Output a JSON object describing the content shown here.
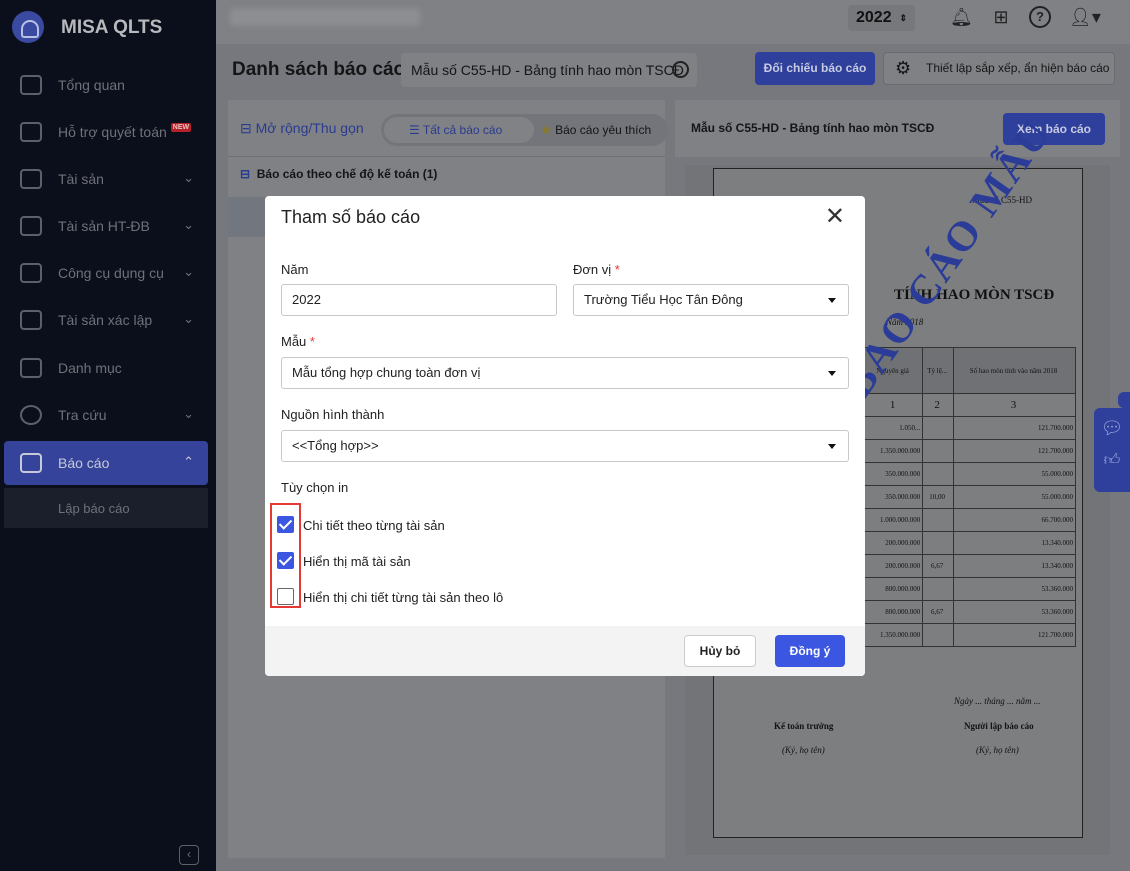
{
  "app": {
    "brand": "MISA QLTS",
    "year": "2022"
  },
  "sidebar": {
    "items": [
      {
        "label": "Tổng quan"
      },
      {
        "label": "Hỗ trợ quyết toán",
        "badge": "NEW"
      },
      {
        "label": "Tài sản"
      },
      {
        "label": "Tài sản HT-ĐB"
      },
      {
        "label": "Công cụ dụng cụ"
      },
      {
        "label": "Tài sản xác lập"
      },
      {
        "label": "Danh mục"
      },
      {
        "label": "Tra cứu"
      },
      {
        "label": "Báo cáo"
      }
    ],
    "sub_item": "Lập báo cáo"
  },
  "header": {
    "title": "Danh sách báo cáo",
    "search_value": "Mẫu số C55-HD - Bảng tính hao mòn TSCĐ",
    "compare_button": "Đối chiếu báo cáo",
    "settings_button": "Thiết lập sắp xếp, ẩn hiện báo cáo"
  },
  "left_panel": {
    "expand_collapse": "Mở rộng/Thu gọn",
    "tab_all": "Tất cả báo cáo",
    "tab_favorite": "Báo cáo yêu thích",
    "group": "Báo cáo theo chế độ kế toán (1)"
  },
  "right_panel": {
    "title": "Mẫu số C55-HD - Bảng tính hao mòn TSCĐ",
    "view_button": "Xem báo cáo",
    "preview": {
      "form_no": "Mẫu số C55-HD",
      "heading": "TÍNH HAO MÒN TSCĐ",
      "year": "Năm 2018",
      "col_headers": [
        "Nguyên giá",
        "Tỷ lệ...",
        "Số hao mòn tính vào năm 2018"
      ],
      "col_numbers": [
        "1",
        "2",
        "3"
      ],
      "rows": [
        [
          "1.050...",
          "",
          "121.700.000"
        ],
        [
          "1.350.000.000",
          "",
          "121.700.000"
        ],
        [
          "350.000.000",
          "",
          "55.000.000"
        ],
        [
          "350.000.000",
          "10,00",
          "55.000.000"
        ],
        [
          "1.000.000.000",
          "",
          "66.700.000"
        ],
        [
          "200.000.000",
          "",
          "13.340.000"
        ],
        [
          "200.000.000",
          "6,67",
          "13.340.000"
        ],
        [
          "800.000.000",
          "",
          "53.360.000"
        ],
        [
          "800.000.000",
          "6,67",
          "53.360.000"
        ],
        [
          "1.350.000.000",
          "",
          "121.700.000"
        ]
      ],
      "date_line": "Ngày ... tháng ... năm ...",
      "signer_left": "Kế toán trưởng",
      "signer_right": "Người lập báo cáo",
      "sign_note_left": "(Ký, họ tên)",
      "sign_note_right": "(Ký, họ tên)",
      "watermark": "BÁO CÁO MẪU"
    }
  },
  "modal": {
    "title": "Tham số báo cáo",
    "year_label": "Năm",
    "year_value": "2022",
    "unit_label": "Đơn vị",
    "unit_value": "Trường Tiểu Học Tân Đông",
    "template_label": "Mẫu",
    "template_value": "Mẫu tổng hợp chung toàn đơn vị",
    "source_label": "Nguồn hình thành",
    "source_value": "<<Tổng hợp>>",
    "print_options_label": "Tùy chọn in",
    "options": [
      {
        "label": "Chi tiết theo từng tài sản",
        "checked": true
      },
      {
        "label": "Hiển thị mã tài sản",
        "checked": true
      },
      {
        "label": "Hiển thị chi tiết từng tài sản theo lô",
        "checked": false
      }
    ],
    "required_mark": "*",
    "cancel": "Hủy bỏ",
    "ok": "Đồng ý"
  }
}
